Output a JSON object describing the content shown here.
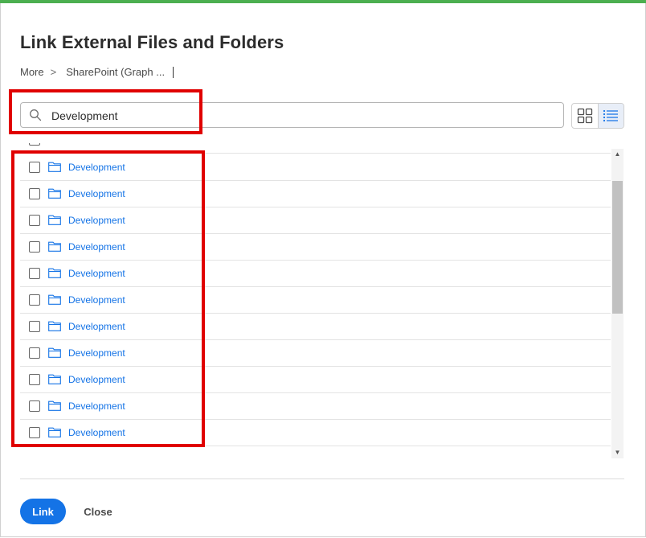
{
  "dialog": {
    "title": "Link External Files and Folders",
    "accent_color": "#4caf50"
  },
  "breadcrumb": {
    "items": [
      "More",
      "SharePoint (Graph ..."
    ],
    "separator": ">"
  },
  "search": {
    "value": "Development",
    "icon": "search-icon"
  },
  "view_toggle": {
    "options": [
      "grid-view-icon",
      "list-view-icon"
    ],
    "active": "list-view-icon"
  },
  "list": {
    "items": [
      "Development",
      "Development",
      "Development",
      "Development",
      "Development",
      "Development",
      "Development",
      "Development",
      "Development",
      "Development",
      "Development"
    ],
    "link_color": "#1473e6",
    "item_icon": "folder-icon"
  },
  "footer": {
    "link_label": "Link",
    "close_label": "Close",
    "primary_color": "#1473e6"
  },
  "annotations": {
    "highlight_color": "#e00000"
  }
}
